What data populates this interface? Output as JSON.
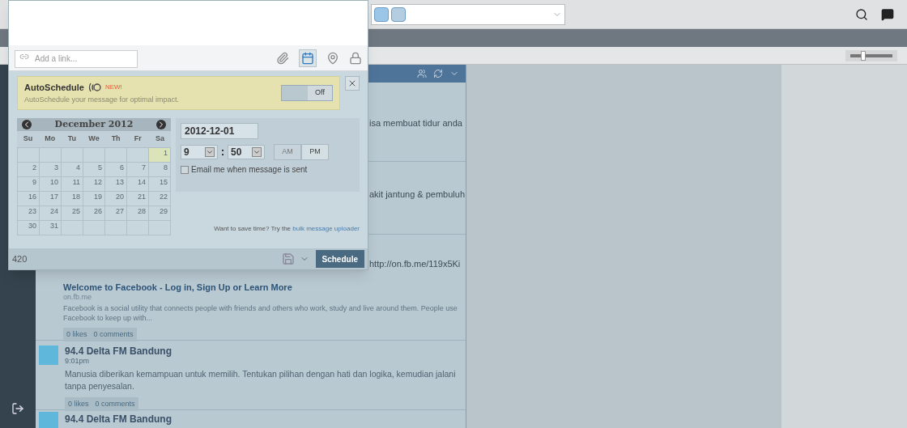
{
  "top_bar": {
    "zoom_slider": {
      "level": 0.3
    }
  },
  "composer": {
    "link_placeholder": "Add a link...",
    "scheduler_active": true,
    "autoschedule": {
      "title": "AutoSchedule",
      "badge": "NEW!",
      "description": "AutoSchedule your message for optimal impact.",
      "toggle_label": "Off",
      "on": false
    },
    "calendar": {
      "month": "December 2012",
      "weekdays": [
        "Su",
        "Mo",
        "Tu",
        "We",
        "Th",
        "Fr",
        "Sa"
      ],
      "weeks": [
        [
          {
            "day": "1",
            "selected": true
          }
        ],
        [
          {
            "day": "2",
            "selected": false
          },
          {
            "day": "3",
            "selected": false
          },
          {
            "day": "4",
            "selected": false
          },
          {
            "day": "5",
            "selected": false
          },
          {
            "day": "6",
            "selected": false
          },
          {
            "day": "7",
            "selected": false
          },
          {
            "day": "8",
            "selected": false
          }
        ],
        [
          {
            "day": "9",
            "selected": false
          },
          {
            "day": "10",
            "selected": false
          },
          {
            "day": "11",
            "selected": false
          },
          {
            "day": "12",
            "selected": false
          },
          {
            "day": "13",
            "selected": false
          },
          {
            "day": "14",
            "selected": false
          },
          {
            "day": "15",
            "selected": false
          }
        ],
        [
          {
            "day": "16",
            "selected": false
          },
          {
            "day": "17",
            "selected": false
          },
          {
            "day": "18",
            "selected": false
          },
          {
            "day": "19",
            "selected": false
          },
          {
            "day": "20",
            "selected": false
          },
          {
            "day": "21",
            "selected": false
          },
          {
            "day": "22",
            "selected": false
          }
        ],
        [
          {
            "day": "23",
            "selected": false
          },
          {
            "day": "24",
            "selected": false
          },
          {
            "day": "25",
            "selected": false
          },
          {
            "day": "26",
            "selected": false
          },
          {
            "day": "27",
            "selected": false
          },
          {
            "day": "28",
            "selected": false
          },
          {
            "day": "29",
            "selected": false
          }
        ],
        [
          {
            "day": "30",
            "selected": false
          },
          {
            "day": "31",
            "selected": false
          }
        ]
      ]
    },
    "date": "2012-12-01",
    "hour": "9",
    "time_separator": ":",
    "minute": "50",
    "meridiem": [
      {
        "label": "AM",
        "selected": false
      },
      {
        "label": "PM",
        "selected": true
      }
    ],
    "email_option": {
      "label": "Email me when message is sent",
      "checked": false
    },
    "bulk_hint": "Want to save time? Try the",
    "bulk_link": "bulk message uploader",
    "char_count": "420",
    "schedule_button": "Schedule"
  },
  "stream": {
    "rows": [
      {
        "kind": "fragment",
        "text": "isa membuat tidur anda"
      },
      {
        "kind": "fragment",
        "text": "akit jantung & pembuluh"
      },
      {
        "kind": "link_fragment",
        "text": "http://on.fb.me/119x5Ki",
        "title": "Welcome to Facebook - Log in, Sign Up or Learn More",
        "domain": "on.fb.me",
        "summary": "Facebook is a social utility that connects people with friends and others who work, study and live around them. People use Facebook to keep up with...",
        "likes": "0 likes",
        "comments": "0 comments"
      },
      {
        "kind": "post",
        "author": "94.4 Delta FM Bandung",
        "time": "9:01pm",
        "text": "Manusia diberikan kemampuan untuk memilih. Tentukan pilihan dengan hati dan logika, kemudian jalani tanpa penyesalan.",
        "likes": "0 likes",
        "comments": "0 comments"
      },
      {
        "kind": "post_header",
        "author": "94.4 Delta FM Bandung"
      }
    ]
  }
}
